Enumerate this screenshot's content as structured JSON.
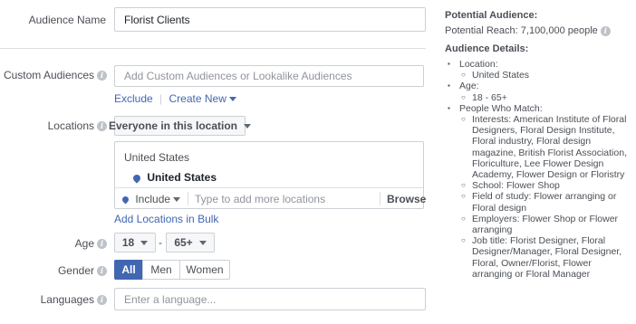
{
  "form": {
    "audience_name_label": "Audience Name",
    "audience_name_value": "Florist Clients",
    "custom_audiences_label": "Custom Audiences",
    "custom_audiences_placeholder": "Add Custom Audiences or Lookalike Audiences",
    "exclude_link": "Exclude",
    "create_new_link": "Create New",
    "locations_label": "Locations",
    "locations_dropdown": "Everyone in this location",
    "location_group_title": "United States",
    "location_selected": "United States",
    "include_dropdown": "Include",
    "locations_search_placeholder": "Type to add more locations",
    "browse_button": "Browse",
    "add_bulk_link": "Add Locations in Bulk",
    "age_label": "Age",
    "age_min": "18",
    "age_separator": "-",
    "age_max": "65+",
    "gender_label": "Gender",
    "gender_options": [
      "All",
      "Men",
      "Women"
    ],
    "gender_selected": "All",
    "languages_label": "Languages",
    "languages_placeholder": "Enter a language..."
  },
  "summary": {
    "potential_audience_heading": "Potential Audience:",
    "potential_reach": "Potential Reach: 7,100,000 people",
    "details_heading": "Audience Details:",
    "details": [
      {
        "label": "Location:",
        "items": [
          "United States"
        ]
      },
      {
        "label": "Age:",
        "items": [
          "18 - 65+"
        ]
      },
      {
        "label": "People Who Match:",
        "items": [
          "Interests: American Institute of Floral Designers, Floral Design Institute, Floral industry, Floral design magazine, British Florist Association, Floriculture, Lee Flower Design Academy, Flower Design or Floristry",
          "School: Flower Shop",
          "Field of study: Flower arranging or Floral design",
          "Employers: Flower Shop or Flower arranging",
          "Job title: Florist Designer, Floral Designer/Manager, Floral Designer, Floral, Owner/Florist, Flower arranging or Floral Manager"
        ]
      }
    ]
  },
  "colors": {
    "accent": "#4267b2",
    "border": "#ccd0d5",
    "label_text": "#4b4f56",
    "placeholder": "#90949c"
  }
}
